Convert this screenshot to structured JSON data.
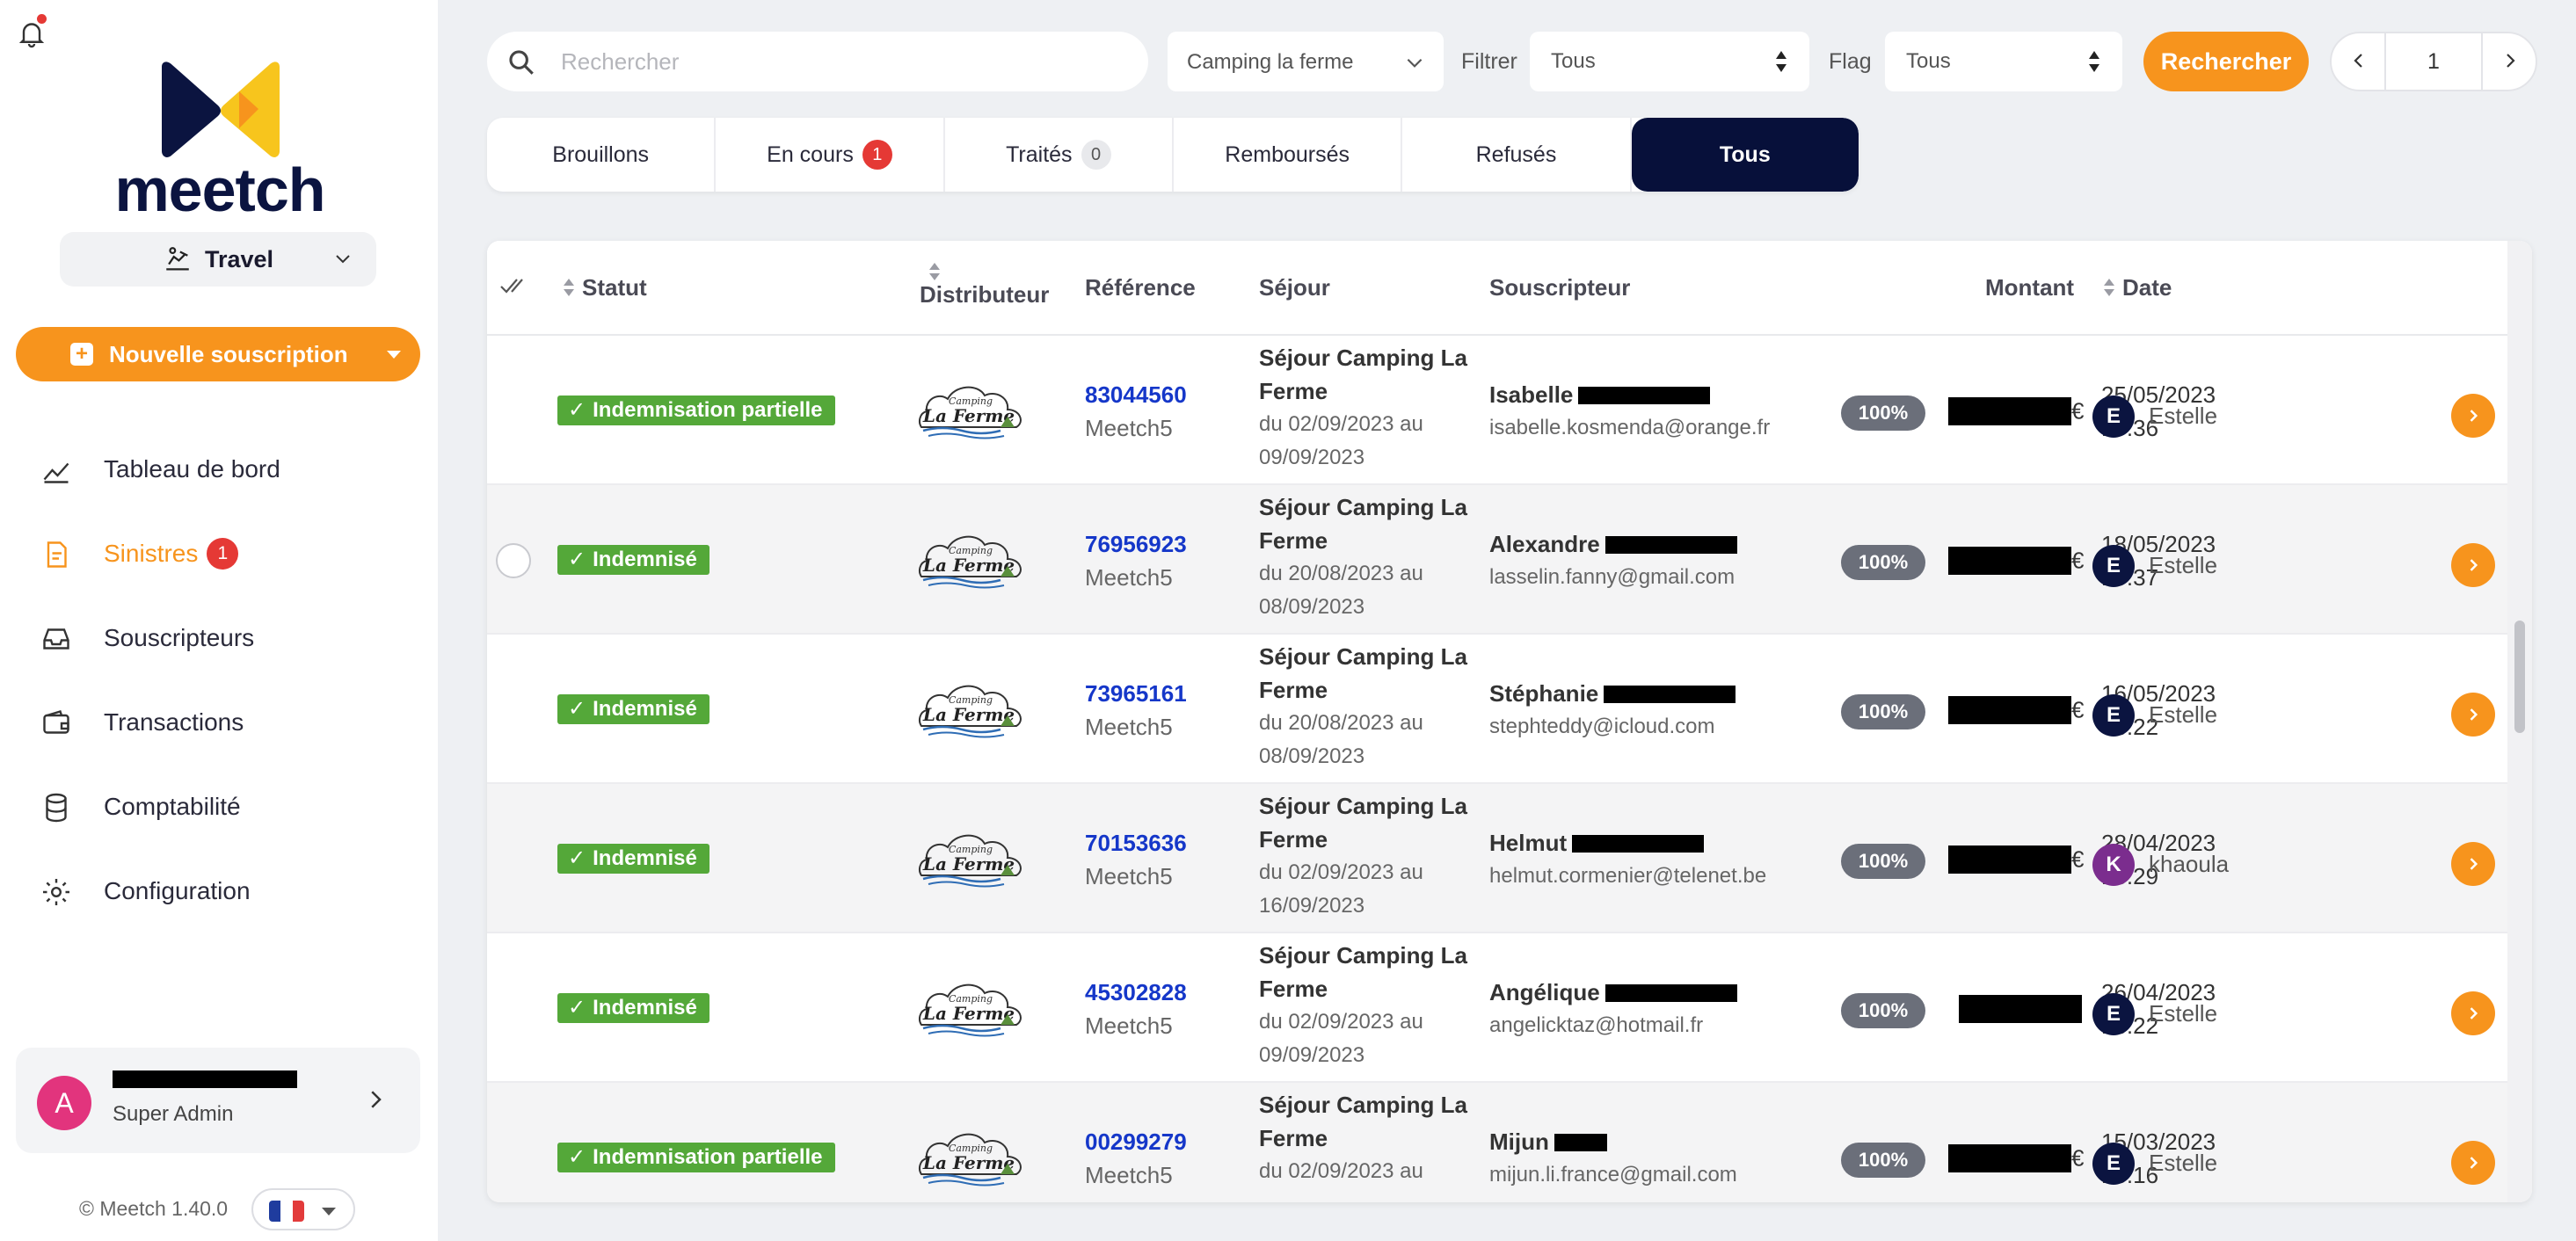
{
  "app": {
    "name": "meetch",
    "version": "© Meetch 1.40.0"
  },
  "sidebar": {
    "product": "Travel",
    "new_button": "Nouvelle souscription",
    "nav": [
      {
        "label": "Tableau de bord",
        "icon": "chart-line-icon"
      },
      {
        "label": "Sinistres",
        "icon": "document-icon",
        "badge": "1",
        "active": true
      },
      {
        "label": "Souscripteurs",
        "icon": "inbox-icon"
      },
      {
        "label": "Transactions",
        "icon": "wallet-icon"
      },
      {
        "label": "Comptabilité",
        "icon": "database-icon"
      },
      {
        "label": "Configuration",
        "icon": "gear-icon"
      }
    ],
    "user": {
      "initial": "A",
      "role": "Super Admin"
    }
  },
  "toolbar": {
    "search_placeholder": "Rechercher",
    "camping": "Camping la ferme",
    "filter_label": "Filtrer",
    "filter_value": "Tous",
    "flag_label": "Flag",
    "flag_value": "Tous",
    "search_button": "Rechercher",
    "page": "1"
  },
  "tabs": [
    {
      "label": "Brouillons"
    },
    {
      "label": "En cours",
      "badge": "1",
      "badge_style": "red"
    },
    {
      "label": "Traités",
      "badge": "0",
      "badge_style": "grey"
    },
    {
      "label": "Remboursés"
    },
    {
      "label": "Refusés"
    },
    {
      "label": "Tous",
      "active": true
    }
  ],
  "table": {
    "headers": {
      "statut": "Statut",
      "distributeur": "Distributeur",
      "reference": "Référence",
      "sejour": "Séjour",
      "souscripteur": "Souscripteur",
      "montant": "Montant",
      "date": "Date"
    },
    "distributor_logo_text": {
      "top": "Camping",
      "bottom": "La Ferme"
    },
    "rows": [
      {
        "status": "Indemnisation partielle",
        "ref": "83044560",
        "distributor": "Meetch5",
        "sejour_title": "Séjour Camping La Ferme",
        "sejour_dates": "du 02/09/2023 au 09/09/2023",
        "name": "Isabelle",
        "email": "isabelle.kosmenda@orange.fr",
        "pct": "100%",
        "currency": "€",
        "date": "25/05/2023",
        "time": "17:36",
        "agent": "Estelle",
        "agent_initial": "E",
        "agent_color": "#0b1440"
      },
      {
        "status": "Indemnisé",
        "ref": "76956923",
        "distributor": "Meetch5",
        "sejour_title": "Séjour Camping La Ferme",
        "sejour_dates": "du 20/08/2023 au 08/09/2023",
        "name": "Alexandre",
        "email": "lasselin.fanny@gmail.com",
        "pct": "100%",
        "currency": "€",
        "date": "18/05/2023",
        "time": "10:37",
        "agent": "Estelle",
        "agent_initial": "E",
        "agent_color": "#0b1440"
      },
      {
        "status": "Indemnisé",
        "ref": "73965161",
        "distributor": "Meetch5",
        "sejour_title": "Séjour Camping La Ferme",
        "sejour_dates": "du 20/08/2023 au 08/09/2023",
        "name": "Stéphanie",
        "email": "stephteddy@icloud.com",
        "pct": "100%",
        "currency": "€",
        "date": "16/05/2023",
        "time": "06:22",
        "agent": "Estelle",
        "agent_initial": "E",
        "agent_color": "#0b1440"
      },
      {
        "status": "Indemnisé",
        "ref": "70153636",
        "distributor": "Meetch5",
        "sejour_title": "Séjour Camping La Ferme",
        "sejour_dates": "du 02/09/2023 au 16/09/2023",
        "name": "Helmut",
        "email": "helmut.cormenier@telenet.be",
        "pct": "100%",
        "currency": "€",
        "date": "28/04/2023",
        "time": "15:29",
        "agent": "khaoula",
        "agent_initial": "K",
        "agent_color": "#7b2d8e"
      },
      {
        "status": "Indemnisé",
        "ref": "45302828",
        "distributor": "Meetch5",
        "sejour_title": "Séjour Camping La Ferme",
        "sejour_dates": "du 02/09/2023 au 09/09/2023",
        "name": "Angélique",
        "email": "angelicktaz@hotmail.fr",
        "pct": "100%",
        "currency": "",
        "date": "26/04/2023",
        "time": "16:22",
        "agent": "Estelle",
        "agent_initial": "E",
        "agent_color": "#0b1440"
      },
      {
        "status": "Indemnisation partielle",
        "ref": "00299279",
        "distributor": "Meetch5",
        "sejour_title": "Séjour Camping La Ferme",
        "sejour_dates": "du 02/09/2023 au",
        "name": "Mijun",
        "email": "mijun.li.france@gmail.com",
        "pct": "100%",
        "currency": "€",
        "date": "15/03/2023",
        "time": "15:16",
        "agent": "Estelle",
        "agent_initial": "E",
        "agent_color": "#0b1440"
      }
    ]
  },
  "colors": {
    "accent": "#f7941d",
    "navy": "#07103a",
    "status_green": "#54a839",
    "link_blue": "#1537c9",
    "badge_red": "#e53935"
  }
}
